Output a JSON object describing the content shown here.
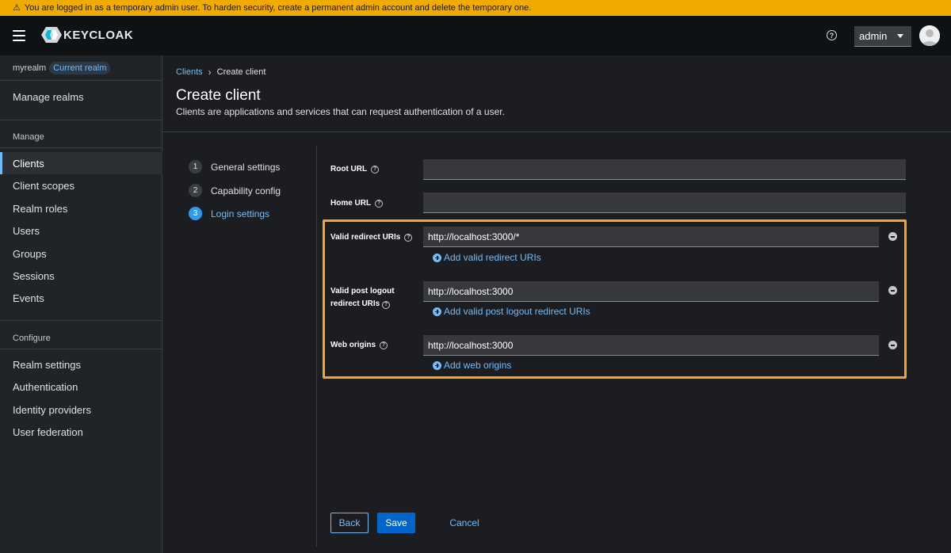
{
  "banner": {
    "text": "You are logged in as a temporary admin user. To harden security, create a permanent admin account and delete the temporary one."
  },
  "masthead": {
    "brand": "KEYCLOAK",
    "user": "admin",
    "help": "?"
  },
  "sidebar": {
    "realm": "myrealm",
    "realm_badge": "Current realm",
    "manage_realms": "Manage realms",
    "manage_section": "Manage",
    "manage_items": [
      "Clients",
      "Client scopes",
      "Realm roles",
      "Users",
      "Groups",
      "Sessions",
      "Events"
    ],
    "configure_section": "Configure",
    "configure_items": [
      "Realm settings",
      "Authentication",
      "Identity providers",
      "User federation"
    ]
  },
  "breadcrumb": {
    "parent": "Clients",
    "current": "Create client"
  },
  "page": {
    "title": "Create client",
    "description": "Clients are applications and services that can request authentication of a user."
  },
  "wizard": {
    "steps": [
      {
        "num": "1",
        "label": "General settings"
      },
      {
        "num": "2",
        "label": "Capability config"
      },
      {
        "num": "3",
        "label": "Login settings"
      }
    ],
    "current_step": 3
  },
  "form": {
    "root_url": {
      "label": "Root URL",
      "value": ""
    },
    "home_url": {
      "label": "Home URL",
      "value": ""
    },
    "redirect_uris": {
      "label": "Valid redirect URIs",
      "value": "http://localhost:3000/*",
      "add": "Add valid redirect URIs"
    },
    "post_logout": {
      "label_1": "Valid post logout",
      "label_2": "redirect URIs",
      "value": "http://localhost:3000",
      "add": "Add valid post logout redirect URIs"
    },
    "web_origins": {
      "label": "Web origins",
      "value": "http://localhost:3000",
      "add": "Add web origins"
    }
  },
  "actions": {
    "back": "Back",
    "save": "Save",
    "cancel": "Cancel"
  },
  "colors": {
    "accent": "#73bcf7",
    "primary": "#0066cc",
    "highlight": "#f5a623",
    "warning": "#f0ab00"
  }
}
